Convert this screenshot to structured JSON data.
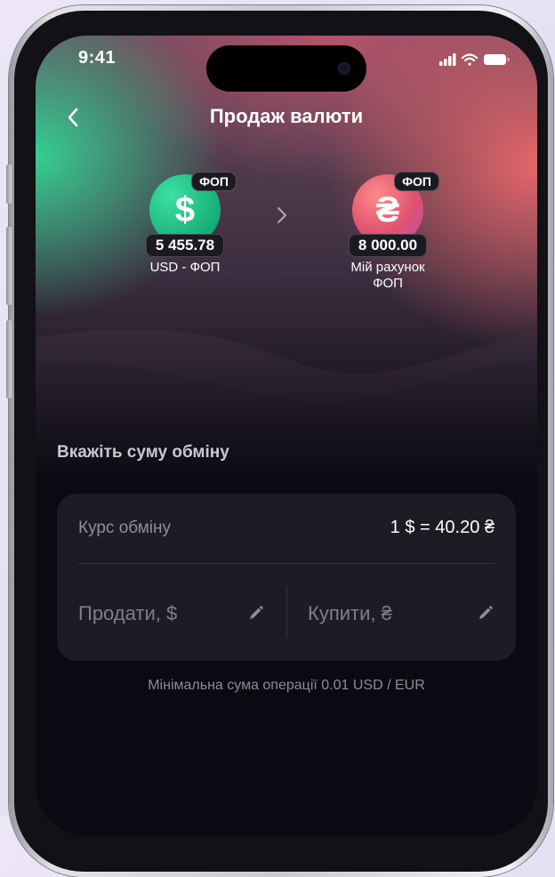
{
  "status": {
    "time": "9:41",
    "icons": [
      "signal-icon",
      "wifi-icon",
      "battery-icon"
    ]
  },
  "nav": {
    "title": "Продаж валюти",
    "back_icon": "chevron-left-icon"
  },
  "accounts": {
    "from": {
      "symbol": "$",
      "tag": "ФОП",
      "amount": "5 455.78",
      "label_line1": "USD - ФОП",
      "color": "#22c98a"
    },
    "to": {
      "symbol": "₴",
      "tag": "ФОП",
      "amount": "8 000.00",
      "label_line1": "Мій рахунок",
      "label_line2": "ФОП",
      "color": "#e3587a"
    },
    "arrow_icon": "chevron-right-icon"
  },
  "exchange": {
    "section_title": "Вкажіть суму обміну",
    "rate_label": "Курс обміну",
    "rate_value": "1 $ = 40.20 ₴",
    "sell_placeholder": "Продати, $",
    "buy_placeholder": "Купити, ₴",
    "edit_icon": "pencil-icon"
  },
  "hint": "Мінімальна сума операції 0.01 USD / EUR",
  "colors": {
    "background": "#0b0a12",
    "card": "#1d1c25",
    "accent_green": "#22c98a",
    "accent_pink": "#e3587a"
  }
}
